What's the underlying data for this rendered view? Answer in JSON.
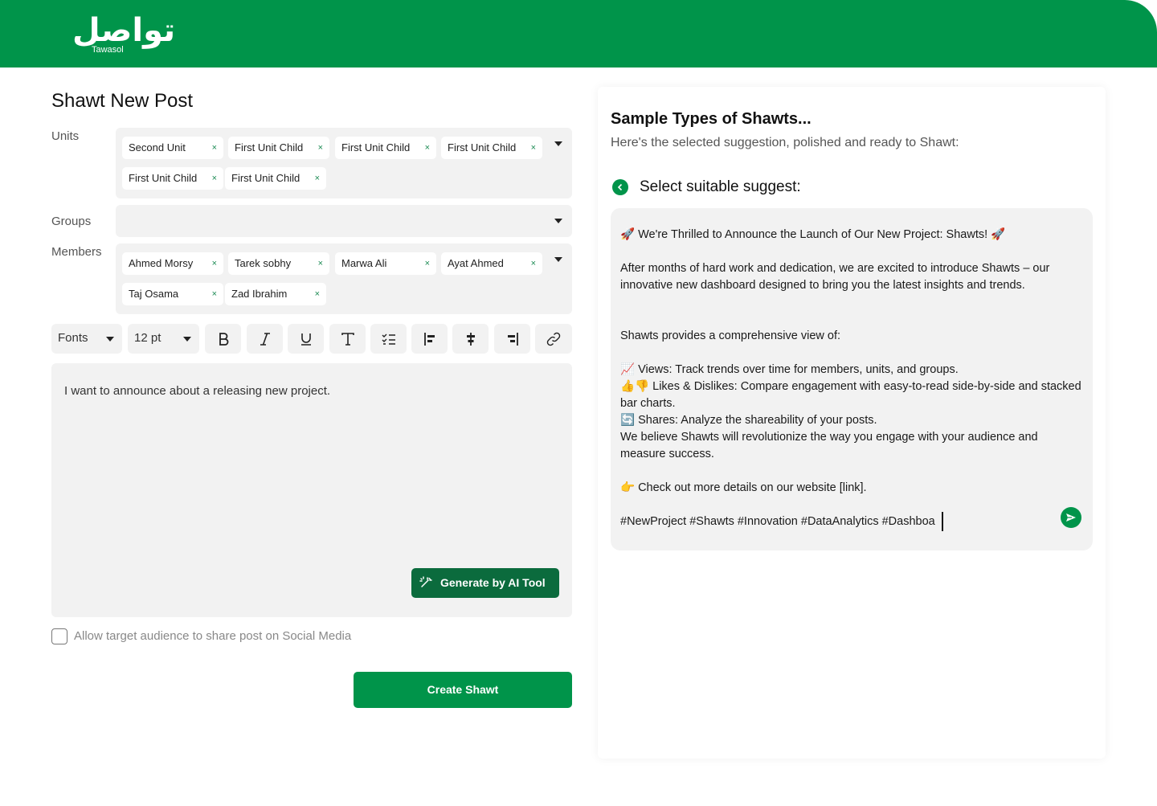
{
  "brand": {
    "arabic_name": "تواصل",
    "latin_name": "Tawasol",
    "color": "#00944a"
  },
  "page": {
    "title": "Shawt New Post"
  },
  "form": {
    "units_label": "Units",
    "units": [
      "Second Unit",
      "First Unit Child",
      "First Unit Child",
      "First Unit Child",
      "First Unit Child",
      "First Unit Child"
    ],
    "groups_label": "Groups",
    "members_label": "Members",
    "members": [
      "Ahmed Morsy",
      "Tarek sobhy",
      "Marwa Ali",
      "Ayat Ahmed",
      "Taj Osama",
      "Zad Ibrahim"
    ],
    "chip_remove": "×"
  },
  "toolbar": {
    "font_value": "Fonts",
    "size_value": "12 pt",
    "buttons": [
      "bold-icon",
      "italic-icon",
      "underline-icon",
      "text-style-icon",
      "checklist-icon",
      "align-left-icon",
      "align-center-icon",
      "align-right-icon",
      "link-icon"
    ]
  },
  "editor": {
    "text": "I want to announce about a releasing new project.",
    "generate_label": "Generate by AI Tool"
  },
  "share": {
    "label": "Allow target audience to share post on Social Media",
    "checked": false
  },
  "actions": {
    "create_label": "Create Shawt"
  },
  "suggestions": {
    "title": "Sample Types of Shawts...",
    "subtitle": "Here's the selected suggestion, polished and ready to Shawt:",
    "select_label": "Select suitable suggest:",
    "lines": [
      "🚀 We're Thrilled to Announce the Launch of Our New Project: Shawts! 🚀",
      "After months of hard work and dedication, we are excited to introduce Shawts – our innovative new dashboard designed to bring you the latest insights and trends.",
      "Shawts provides a comprehensive view of:",
      "📈 Views: Track trends over time for members, units, and groups.",
      "👍👎 Likes & Dislikes: Compare engagement with easy-to-read side-by-side and stacked bar charts.",
      "🔄 Shares: Analyze the shareability of your posts.",
      "We believe Shawts will revolutionize the way you engage with your audience and measure success.",
      "👉 Check out more details on our website [link].",
      "#NewProject #Shawts #Innovation #DataAnalytics #Dashboa"
    ]
  }
}
